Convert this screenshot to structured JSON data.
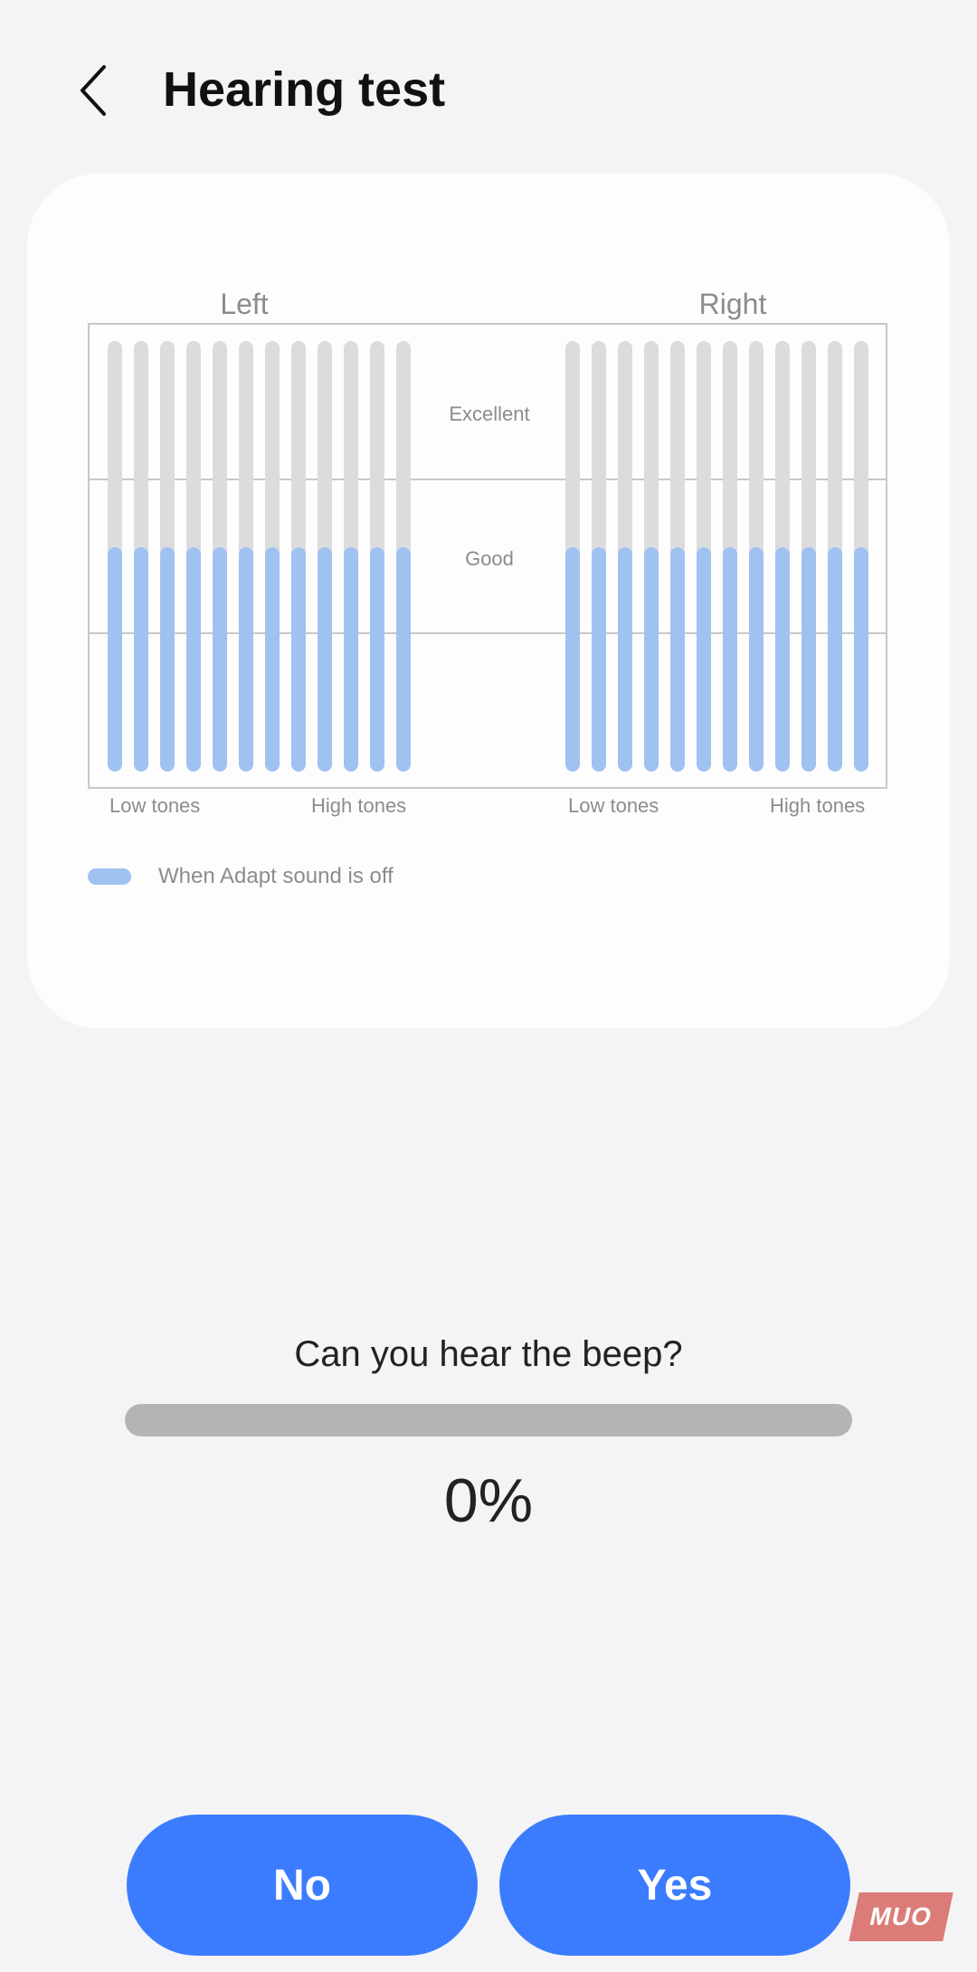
{
  "header": {
    "title": "Hearing test"
  },
  "chart_data": {
    "type": "bar",
    "levels": [
      "Excellent",
      "Good"
    ],
    "panels": [
      {
        "name": "Left",
        "xlabel_low": "Low tones",
        "xlabel_high": "High tones",
        "values": [
          0.52,
          0.52,
          0.52,
          0.52,
          0.52,
          0.52,
          0.52,
          0.52,
          0.52,
          0.52,
          0.52,
          0.52
        ]
      },
      {
        "name": "Right",
        "xlabel_low": "Low tones",
        "xlabel_high": "High tones",
        "values": [
          0.52,
          0.52,
          0.52,
          0.52,
          0.52,
          0.52,
          0.52,
          0.52,
          0.52,
          0.52,
          0.52,
          0.52
        ]
      }
    ],
    "legend": "When Adapt sound is off",
    "colors": {
      "fill": "#9fc2f0",
      "track": "#dcdcde"
    }
  },
  "test": {
    "question": "Can you hear the beep?",
    "progress": 0,
    "progress_text": "0%"
  },
  "buttons": {
    "no": "No",
    "yes": "Yes"
  },
  "watermark": "MUO",
  "colors": {
    "accent": "#3b7cff",
    "background": "#f4f4f6"
  }
}
